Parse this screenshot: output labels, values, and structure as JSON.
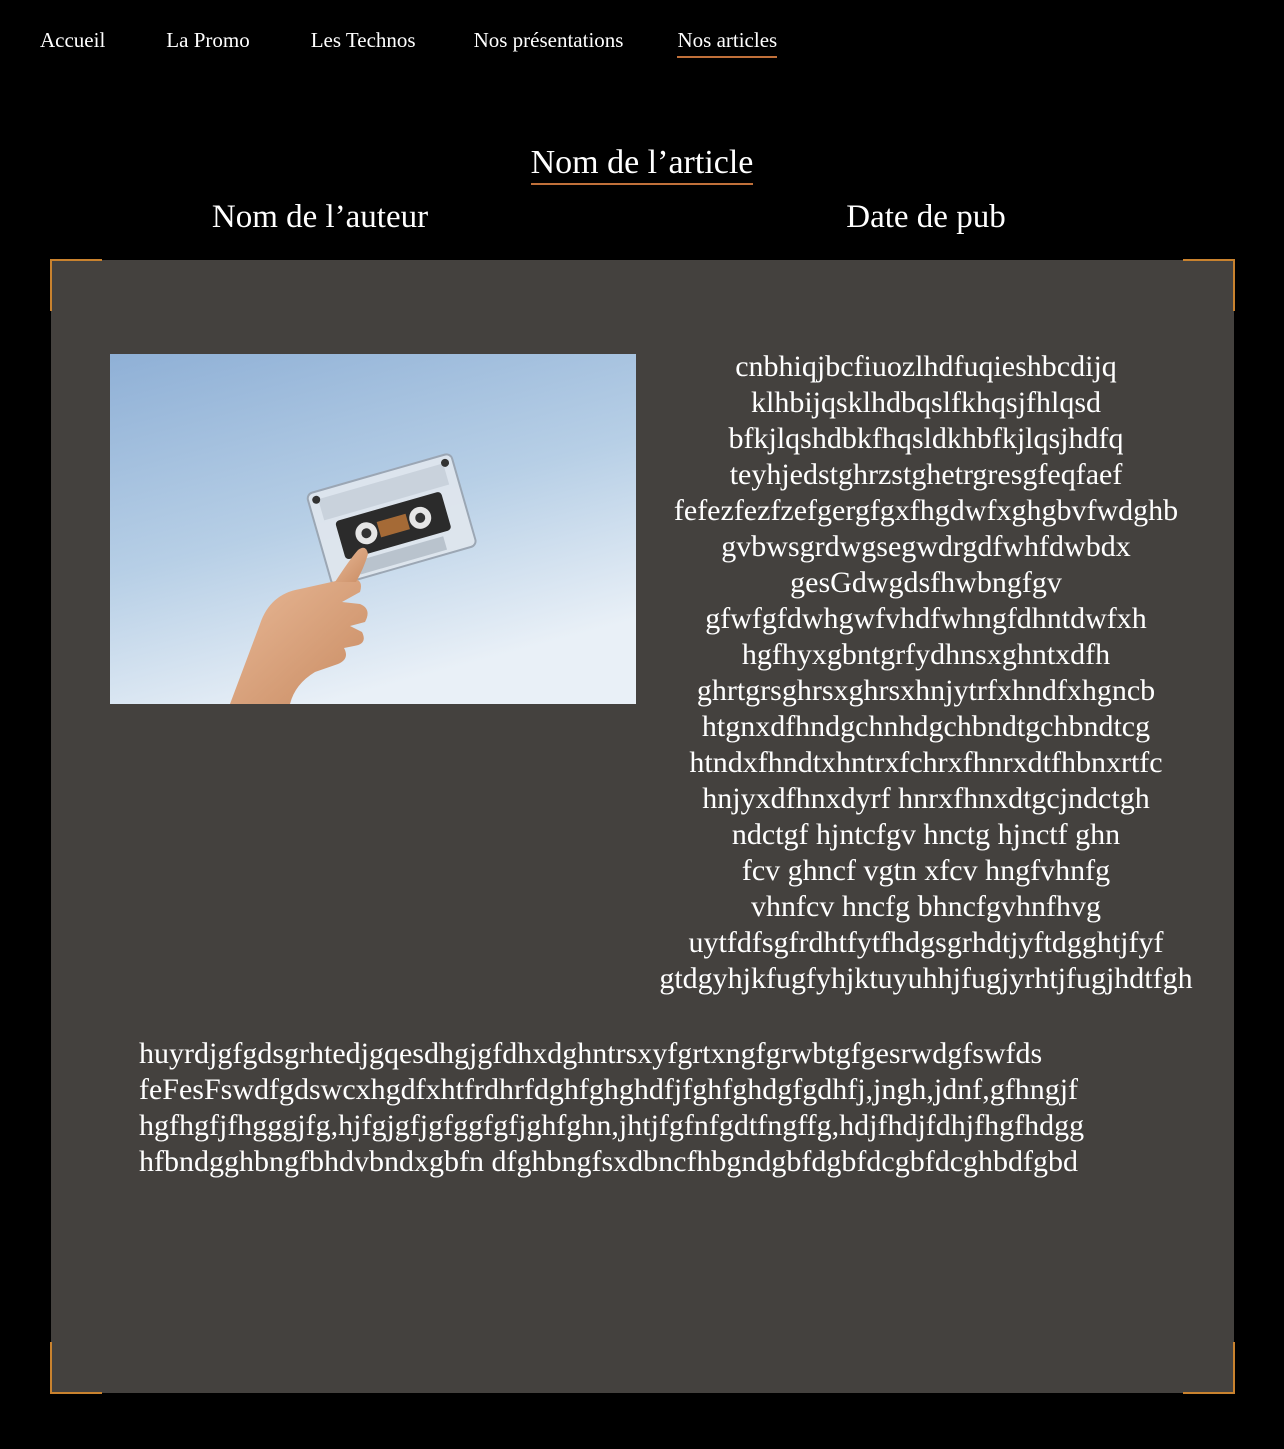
{
  "nav": {
    "items": [
      {
        "label": "Accueil"
      },
      {
        "label": "La Promo"
      },
      {
        "label": "Les Technos"
      },
      {
        "label": "Nos présentations"
      },
      {
        "label": "Nos articles",
        "active": true
      }
    ]
  },
  "article": {
    "title": "Nom de l’article",
    "author": "Nom de l’auteur",
    "date": "Date de pub",
    "image_icon": "cassette-photo",
    "side_text": [
      "cnbhiqjbcfiuozlhdfuqieshbcdijq",
      "klhbijqsklhdbqslfkhqsjfhlqsd",
      "bfkjlqshdbkfhqsldkhbfkjlqsjhdfq",
      "teyhjedstghrzstghetrgresgfeqfaef",
      "fefezfezfzefgergfgxfhgdwfxghgbvfwdghb",
      "gvbwsgrdwgsegwdrgdfwhfdwbdx",
      "gesGdwgdsfhwbngfgv",
      "gfwfgfdwhgwfvhdfwhngfdhntdwfxh",
      "hgfhyxgbntgrfydhnsxghntxdfh",
      "ghrtgrsghrsxghrsxhnjytrfxhndfxhgncb",
      "htgnxdfhndgchnhdgchbndtgchbndtcg",
      "htndxfhndtxhntrxfchrxfhnrxdtfhbnxrtfc",
      "hnjyxdfhnxdyrf hnrxfhnxdtgcjndctgh",
      "ndctgf hjntcfgv hnctg hjnctf ghn",
      "fcv ghncf vgtn xfcv hngfvhnfg",
      "vhnfcv hncfg bhncfgvhnfhvg",
      "uytfdfsgfrdhtfytfhdgsgrhdtjyftdgghtjfyf",
      "gtdgyhjkfugfyhjktuyuhhjfugjyrhtjfugjhdtfgh"
    ],
    "body_text": [
      "huyrdjgfgdsgrhtedjgqesdhgjgfdhxdghntrsxyfgrtxngfgrwbtgfgesrwdgfswfds",
      "feFesFswdfgdswcxhgdfxhtfrdhrfdghfghghdfjfghfghdgfgdhfj,jngh,jdnf,gfhngjf",
      "hgfhgfjfhgggjfg,hjfgjgfjgfggfgfjghfghn,jhtjfgfnfgdtfngffg,hdjfhdjfdhjfhgfhdgg",
      "hfbndgghbngfbhdvbndxgbfn dfghbngfsxdbncfhbgndgbfdgbfdcgbfdcghbdfgbd"
    ]
  },
  "colors": {
    "background": "#000000",
    "card": "#44413e",
    "accent": "#c9822e",
    "text": "#ffffff"
  }
}
